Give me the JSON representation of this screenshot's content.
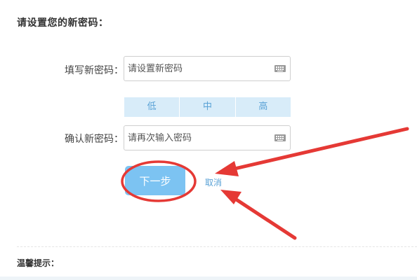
{
  "section_title": "请设置您的新密码：",
  "form": {
    "new_password": {
      "label": "填写新密码：",
      "placeholder": "请设置新密码",
      "icon": "keyboard-icon"
    },
    "strength": {
      "levels": [
        "低",
        "中",
        "高"
      ]
    },
    "confirm_password": {
      "label": "确认新密码：",
      "placeholder": "请再次输入密码",
      "icon": "keyboard-icon"
    }
  },
  "actions": {
    "next_label": "下一步",
    "cancel_label": "取消"
  },
  "tips": {
    "title": "温馨提示："
  },
  "colors": {
    "accent": "#7cc3f2",
    "link": "#5aa2d6",
    "strength_bg": "#d8ecf9",
    "annotation_red": "#e53935"
  }
}
